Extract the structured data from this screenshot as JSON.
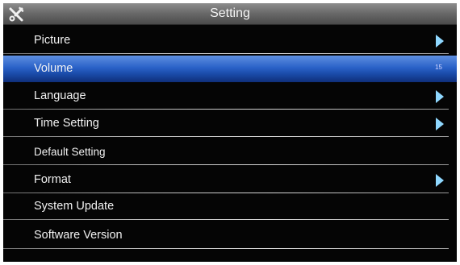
{
  "header": {
    "title": "Setting",
    "left_icon": "tools-icon"
  },
  "menu": {
    "items": [
      {
        "label": "Picture",
        "has_submenu": true,
        "selected": false
      },
      {
        "label": "Volume",
        "value": "15",
        "has_submenu": false,
        "selected": true
      },
      {
        "label": "Language",
        "has_submenu": true,
        "selected": false
      },
      {
        "label": "Time Setting",
        "has_submenu": true,
        "selected": false
      },
      {
        "label": "Default Setting",
        "has_submenu": false,
        "selected": false
      },
      {
        "label": "Format",
        "has_submenu": true,
        "selected": false
      },
      {
        "label": "System Update",
        "has_submenu": false,
        "selected": false
      },
      {
        "label": "Software Version",
        "has_submenu": false,
        "selected": false
      }
    ],
    "arrow_icon": "chevron-right-icon"
  },
  "colors": {
    "background": "#050505",
    "selected_highlight": "#2a62c8",
    "arrow": "#8fd8ff",
    "text": "#f2f2f2"
  }
}
